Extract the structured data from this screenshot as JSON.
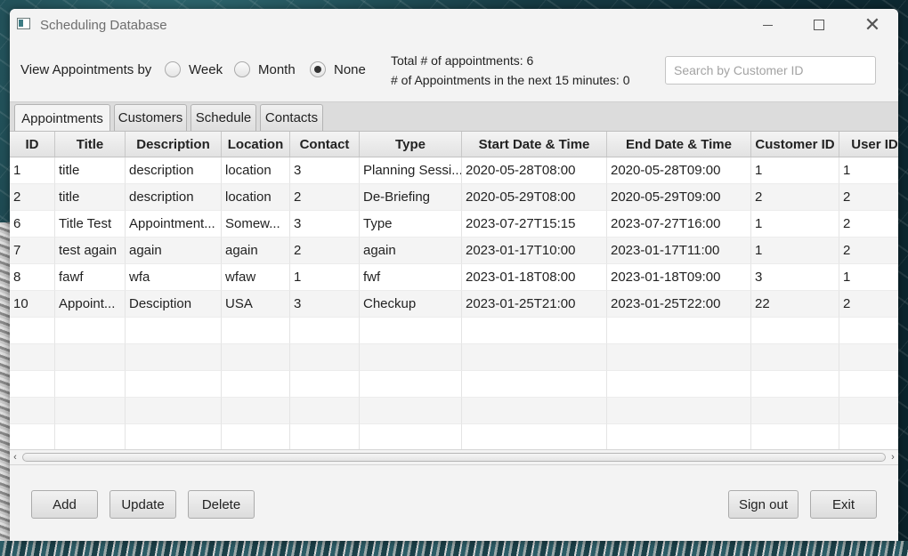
{
  "window": {
    "title": "Scheduling Database"
  },
  "filter": {
    "label": "View Appointments by",
    "options": [
      {
        "label": "Week",
        "selected": false
      },
      {
        "label": "Month",
        "selected": false
      },
      {
        "label": "None",
        "selected": true
      }
    ]
  },
  "stats": {
    "total": "Total # of appointments: 6",
    "upcoming": "# of Appointments in the next 15 minutes: 0"
  },
  "search": {
    "placeholder": "Search by Customer ID",
    "value": ""
  },
  "tabs": [
    {
      "label": "Appointments",
      "active": true
    },
    {
      "label": "Customers",
      "active": false
    },
    {
      "label": "Schedule",
      "active": false
    },
    {
      "label": "Contacts",
      "active": false
    }
  ],
  "table": {
    "columns": [
      "ID",
      "Title",
      "Description",
      "Location",
      "Contact",
      "Type",
      "Start Date & Time",
      "End Date & Time",
      "Customer ID",
      "User ID"
    ],
    "rows": [
      [
        "1",
        "title",
        "description",
        "location",
        "3",
        "Planning Sessi...",
        "2020-05-28T08:00",
        "2020-05-28T09:00",
        "1",
        "1"
      ],
      [
        "2",
        "title",
        "description",
        "location",
        "2",
        "De-Briefing",
        "2020-05-29T08:00",
        "2020-05-29T09:00",
        "2",
        "2"
      ],
      [
        "6",
        "Title Test",
        "Appointment...",
        "Somew...",
        "3",
        "Type",
        "2023-07-27T15:15",
        "2023-07-27T16:00",
        "1",
        "2"
      ],
      [
        "7",
        "test again",
        "again",
        "again",
        "2",
        "again",
        "2023-01-17T10:00",
        "2023-01-17T11:00",
        "1",
        "2"
      ],
      [
        "8",
        "fawf",
        "wfa",
        "wfaw",
        "1",
        "fwf",
        "2023-01-18T08:00",
        "2023-01-18T09:00",
        "3",
        "1"
      ],
      [
        "10",
        "Appoint...",
        "Desciption",
        "USA",
        "3",
        "Checkup",
        "2023-01-25T21:00",
        "2023-01-25T22:00",
        "22",
        "2"
      ]
    ]
  },
  "buttons": {
    "add": "Add",
    "update": "Update",
    "delete": "Delete",
    "sign_out": "Sign out",
    "exit": "Exit"
  },
  "window_controls": {
    "close_glyph": "✕"
  }
}
